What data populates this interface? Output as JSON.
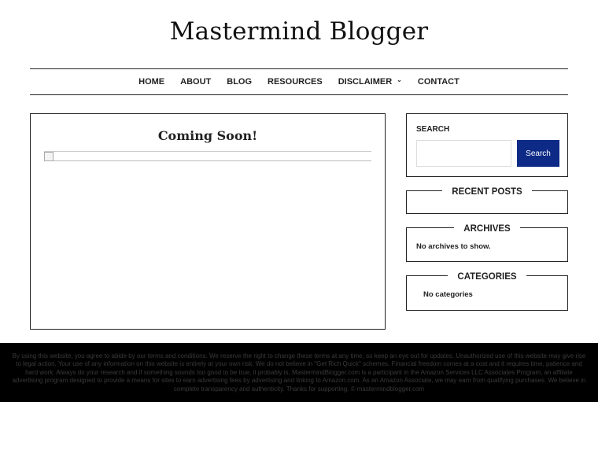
{
  "site": {
    "title": "Mastermind Blogger"
  },
  "nav": {
    "items": [
      {
        "label": "HOME"
      },
      {
        "label": "ABOUT"
      },
      {
        "label": "BLOG"
      },
      {
        "label": "RESOURCES"
      },
      {
        "label": "DISCLAIMER",
        "has_dropdown": true
      },
      {
        "label": "CONTACT"
      }
    ]
  },
  "main": {
    "post_title": "Coming Soon!"
  },
  "sidebar": {
    "search": {
      "heading": "SEARCH",
      "input_value": "",
      "button_label": "Search",
      "button_color": "#0d2a86"
    },
    "recent_posts": {
      "heading": "RECENT POSTS"
    },
    "archives": {
      "heading": "ARCHIVES",
      "empty_text": "No archives to show."
    },
    "categories": {
      "heading": "CATEGORIES",
      "empty_text": "No categories"
    }
  },
  "footer": {
    "text": "By using this website, you agree to abide by our terms and conditions. We reserve the right to change these terms at any time, so keep an eye out for updates. Unauthorized use of this website may give rise to legal action. Your use of any information on this website is entirely at your own risk. We do not believe in \"Get Rich Quick\" schemes. Financial freedom comes at a cost and it requires time, patience and hard work. Always do your research and if something sounds too good to be true, it probably is. MastermindBlogger.com is a participant in the Amazon Services LLC Associates Program, an affiliate advertising program designed to provide a means for sites to earn advertising fees by advertising and linking to Amazon.com. As an Amazon Associate, we may earn from qualifying purchases. We believe in complete transparency and authenticity. Thanks for supporting. © mastermindblogger.com"
  }
}
